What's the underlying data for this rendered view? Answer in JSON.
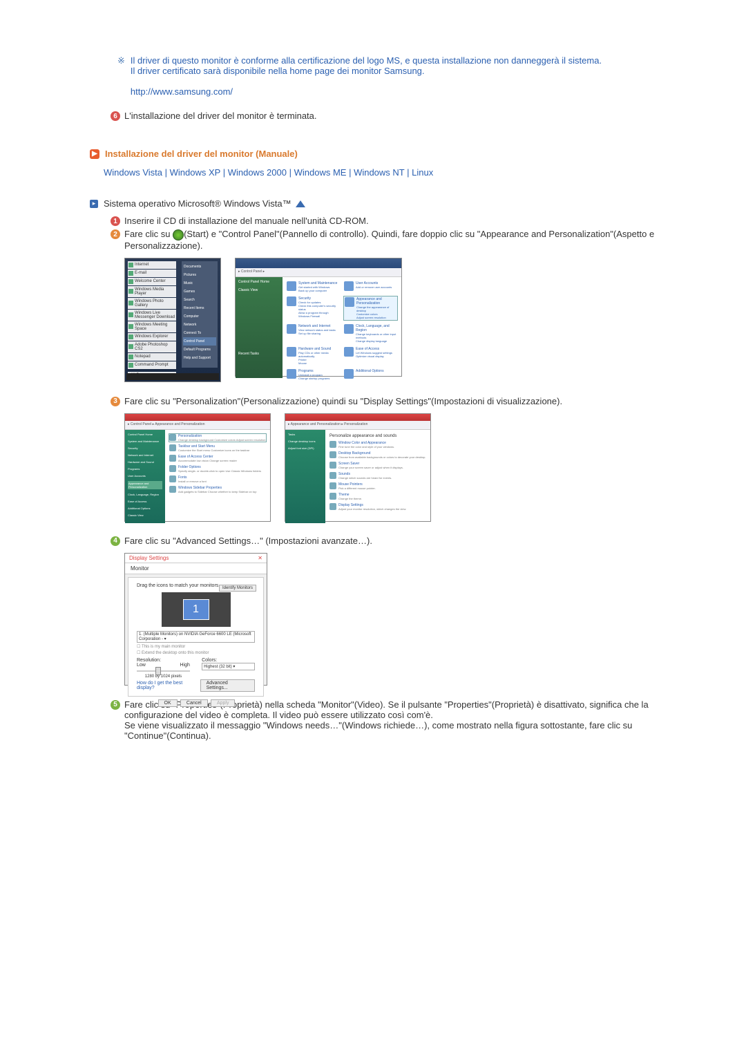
{
  "note": {
    "line1": "Il driver di questo monitor è conforme alla certificazione del logo MS, e questa installazione non danneggerà il sistema.",
    "line2": "Il driver certificato sarà disponibile nella home page dei monitor Samsung.",
    "url": "http://www.samsung.com/"
  },
  "step6_text": "L'installazione del driver del monitor è terminata.",
  "section_title": "Installazione del driver del monitor (Manuale)",
  "os_links": {
    "vista": "Windows Vista",
    "xp": "Windows XP",
    "w2000": "Windows 2000",
    "wme": "Windows ME",
    "wnt": "Windows NT",
    "linux": "Linux",
    "sep": " | "
  },
  "os_intro": "Sistema operativo Microsoft® Windows Vista™",
  "vista_steps": {
    "s1": "Inserire il CD di installazione del manuale nell'unità CD-ROM.",
    "s2a": "Fare clic su ",
    "s2b": "(Start) e \"Control Panel\"(Pannello di controllo). Quindi, fare doppio clic su \"Appearance and Personalization\"(Aspetto e Personalizzazione).",
    "s3": "Fare clic su \"Personalization\"(Personalizzazione) quindi su \"Display Settings\"(Impostazioni di visualizzazione).",
    "s4": "Fare clic su \"Advanced Settings…\" (Impostazioni avanzate…).",
    "s5": "Fare clic su \"Properties\"(Proprietà) nella scheda \"Monitor\"(Video). Se il pulsante \"Properties\"(Proprietà) è disattivato, significa che la configurazione del video è completa. Il video può essere utilizzato così com'è.\nSe viene visualizzato il messaggio \"Windows needs…\"(Windows richiede…), come mostrato nella figura sottostante, fare clic su \"Continue\"(Continua)."
  },
  "start_menu": {
    "items": [
      "Internet",
      "E-mail",
      "Welcome Center",
      "Windows Media Player",
      "Windows Photo Gallery",
      "Windows Live Messenger Download",
      "Windows Meeting Space",
      "Windows Explorer",
      "Adobe Photoshop CS2",
      "Notepad",
      "Command Prompt"
    ],
    "right": [
      "Documents",
      "Pictures",
      "Music",
      "Games",
      "Search",
      "Recent Items",
      "Computer",
      "Network",
      "Connect To",
      "Control Panel",
      "Default Programs",
      "Help and Support"
    ],
    "all": "All Programs"
  },
  "control_panel": {
    "title": "Control Panel",
    "nav": "Control Panel ▸",
    "side": [
      "Control Panel Home",
      "Classic View"
    ],
    "side_bottom": [
      "Recent Tasks"
    ],
    "cats": [
      {
        "t": "System and Maintenance",
        "d": "Get started with Windows\nBack up your computer"
      },
      {
        "t": "User Accounts",
        "d": "Add or remove user accounts"
      },
      {
        "t": "Security",
        "d": "Check for updates\nCheck this computer's security status\nAllow a program through Windows Firewall"
      },
      {
        "t": "Appearance and Personalization",
        "d": "Change the appearance of desktop\nCustomize colors\nAdjust screen resolution",
        "hl": true
      },
      {
        "t": "Network and Internet",
        "d": "View network status and tasks\nSet up file sharing"
      },
      {
        "t": "Clock, Language, and Region",
        "d": "Change keyboards or other input methods\nChange display language"
      },
      {
        "t": "Hardware and Sound",
        "d": "Play CDs or other media automatically\nPrinter\nMouse"
      },
      {
        "t": "Ease of Access",
        "d": "Let Windows suggest settings\nOptimize visual display"
      },
      {
        "t": "Programs",
        "d": "Uninstall a program\nChange startup programs"
      },
      {
        "t": "Additional Options",
        "d": ""
      }
    ]
  },
  "pers_left": {
    "side": [
      "Control Panel Home",
      "System and Maintenance",
      "Security",
      "Network and Internet",
      "Hardware and Sound",
      "Programs",
      "User Accounts",
      "Appearance and Personalization",
      "Clock, Language, Region",
      "Ease of Access",
      "Additional Options",
      "Classic View"
    ],
    "items": [
      {
        "t": "Personalization",
        "d": "Change desktop background  Customize colors  Adjust screen resolution",
        "hl": true
      },
      {
        "t": "Taskbar and Start Menu",
        "d": "Customize the Start menu  Customize icons on the taskbar"
      },
      {
        "t": "Ease of Access Center",
        "d": "Accommodate low vision  Change screen reader"
      },
      {
        "t": "Folder Options",
        "d": "Specify single- or double-click to open  Use Classic Windows folders"
      },
      {
        "t": "Fonts",
        "d": "Install or remove a font"
      },
      {
        "t": "Windows Sidebar Properties",
        "d": "Add gadgets to Sidebar  Choose whether to keep Sidebar on top"
      }
    ]
  },
  "pers_right": {
    "title": "Personalize appearance and sounds",
    "side": [
      "Tasks",
      "Change desktop icons",
      "Adjust font size (DPI)"
    ],
    "items": [
      {
        "t": "Window Color and Appearance",
        "d": "Fine tune the color and style of your windows."
      },
      {
        "t": "Desktop Background",
        "d": "Choose from available backgrounds or colors to decorate your desktop."
      },
      {
        "t": "Screen Saver",
        "d": "Change your screen saver or adjust when it displays."
      },
      {
        "t": "Sounds",
        "d": "Change which sounds are heard for events."
      },
      {
        "t": "Mouse Pointers",
        "d": "Pick a different mouse pointer."
      },
      {
        "t": "Theme",
        "d": "Change the theme."
      },
      {
        "t": "Display Settings",
        "d": "Adjust your monitor resolution, which changes the view."
      }
    ]
  },
  "display_settings": {
    "title": "Display Settings",
    "tab": "Monitor",
    "drag": "Drag the icons to match your monitors.",
    "identify": "Identify Monitors",
    "monnum": "1",
    "dropdown": "1. (Multiple Monitors) on NVIDIA GeForce 6600 LE (Microsoft Corporation - ▾",
    "chk1": "This is my main monitor",
    "chk2": "Extend the desktop onto this monitor",
    "reslabel": "Resolution:",
    "low": "Low",
    "high": "High",
    "restext": "1280 by 1024 pixels",
    "collabel": "Colors:",
    "colval": "Highest (32 bit)   ▾",
    "helplink": "How do I get the best display?",
    "adv": "Advanced Settings...",
    "ok": "OK",
    "cancel": "Cancel",
    "apply": "Apply"
  }
}
